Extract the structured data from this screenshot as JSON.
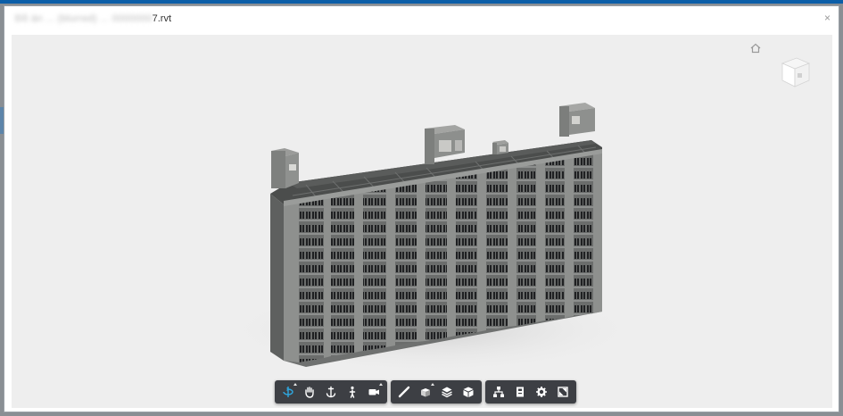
{
  "window": {
    "title_obscured": "Đồ án ... (blurred) ... 0000000",
    "title_suffix": "7.rvt",
    "close_label": "×"
  },
  "viewer": {
    "background": "#eeeeee",
    "accent": "#2fa6de"
  },
  "toolbar": {
    "groups": [
      {
        "name": "navigation",
        "tools": [
          {
            "name": "orbit",
            "icon": "orbit-icon",
            "active": true,
            "has_menu": true
          },
          {
            "name": "pan",
            "icon": "hand-icon",
            "active": false,
            "has_menu": false
          },
          {
            "name": "zoom",
            "icon": "anchor-zoom-icon",
            "active": false,
            "has_menu": false
          },
          {
            "name": "first-person",
            "icon": "person-icon",
            "active": false,
            "has_menu": false
          },
          {
            "name": "camera",
            "icon": "camera-icon",
            "active": false,
            "has_menu": true
          }
        ]
      },
      {
        "name": "modeling",
        "tools": [
          {
            "name": "measure",
            "icon": "ruler-icon",
            "active": false,
            "has_menu": false
          },
          {
            "name": "section",
            "icon": "section-box-icon",
            "active": false,
            "has_menu": true
          },
          {
            "name": "explode",
            "icon": "layers-icon",
            "active": false,
            "has_menu": false
          },
          {
            "name": "model-view",
            "icon": "cube-icon",
            "active": false,
            "has_menu": false
          }
        ]
      },
      {
        "name": "settings",
        "tools": [
          {
            "name": "model-browser",
            "icon": "hierarchy-icon",
            "active": false,
            "has_menu": false
          },
          {
            "name": "properties",
            "icon": "properties-icon",
            "active": false,
            "has_menu": false
          },
          {
            "name": "settings",
            "icon": "gear-icon",
            "active": false,
            "has_menu": false
          },
          {
            "name": "fullscreen",
            "icon": "fullscreen-icon",
            "active": false,
            "has_menu": false
          }
        ]
      }
    ]
  }
}
